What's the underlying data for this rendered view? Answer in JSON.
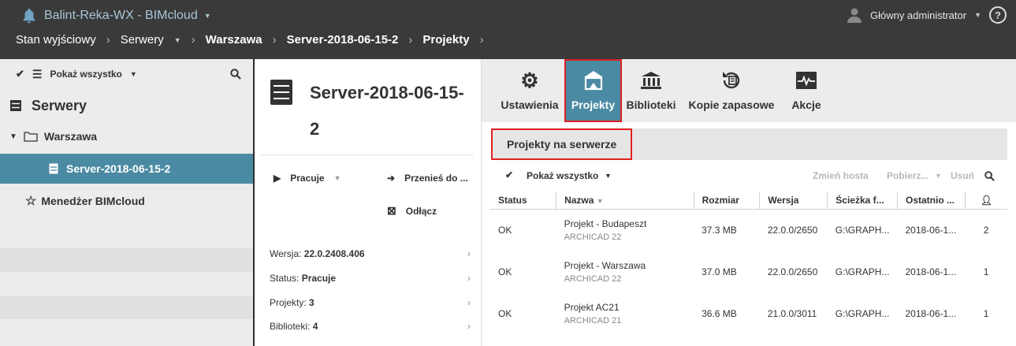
{
  "app": {
    "title": "Balint-Reka-WX - BIMcloud"
  },
  "user": {
    "name": "Główny administrator",
    "help": "?"
  },
  "breadcrumbs": [
    "Stan wyjściowy",
    "Serwery",
    "Warszawa",
    "Server-2018-06-15-2",
    "Projekty"
  ],
  "left_panel": {
    "filter_label": "Pokaż wszystko",
    "section": "Serwery",
    "items": [
      {
        "label": "Warszawa"
      },
      {
        "label": "Server-2018-06-15-2"
      },
      {
        "label": "Menedżer BIMcloud"
      }
    ]
  },
  "server_panel": {
    "title": "Server-2018-06-15-2",
    "status_action": "Pracuje",
    "move_action": "Przenieś do ...",
    "disconnect_action": "Odłącz",
    "info": [
      {
        "label": "Wersja:",
        "value": "22.0.2408.406"
      },
      {
        "label": "Status:",
        "value": "Pracuje"
      },
      {
        "label": "Projekty:",
        "value": "3"
      },
      {
        "label": "Biblioteki:",
        "value": "4"
      }
    ]
  },
  "tabs": [
    "Ustawienia",
    "Projekty",
    "Biblioteki",
    "Kopie zapasowe",
    "Akcje"
  ],
  "projects_section": {
    "title": "Projekty na serwerze",
    "filter_label": "Pokaż wszystko",
    "actions": {
      "change_host": "Zmień hosta",
      "download": "Pobierz...",
      "delete": "Usuń"
    },
    "columns": [
      "Status",
      "Nazwa",
      "Rozmiar",
      "Wersja",
      "Ścieżka f...",
      "Ostatnio ..."
    ],
    "rows": [
      {
        "status": "OK",
        "name": "Projekt - Budapeszt",
        "app": "ARCHICAD 22",
        "size": "37.3 MB",
        "version": "22.0.0/2650",
        "path": "G:\\GRAPH...",
        "last": "2018-06-1...",
        "users": "2"
      },
      {
        "status": "OK",
        "name": "Projekt - Warszawa",
        "app": "ARCHICAD 22",
        "size": "37.0 MB",
        "version": "22.0.0/2650",
        "path": "G:\\GRAPH...",
        "last": "2018-06-1...",
        "users": "1"
      },
      {
        "status": "OK",
        "name": "Projekt AC21",
        "app": "ARCHICAD 21",
        "size": "36.6 MB",
        "version": "21.0.0/3011",
        "path": "G:\\GRAPH...",
        "last": "2018-06-1...",
        "users": "1"
      }
    ]
  },
  "colors": {
    "topbar": "#3a3a3a",
    "accent": "#4b8aa3",
    "highlight": "#e02020"
  }
}
